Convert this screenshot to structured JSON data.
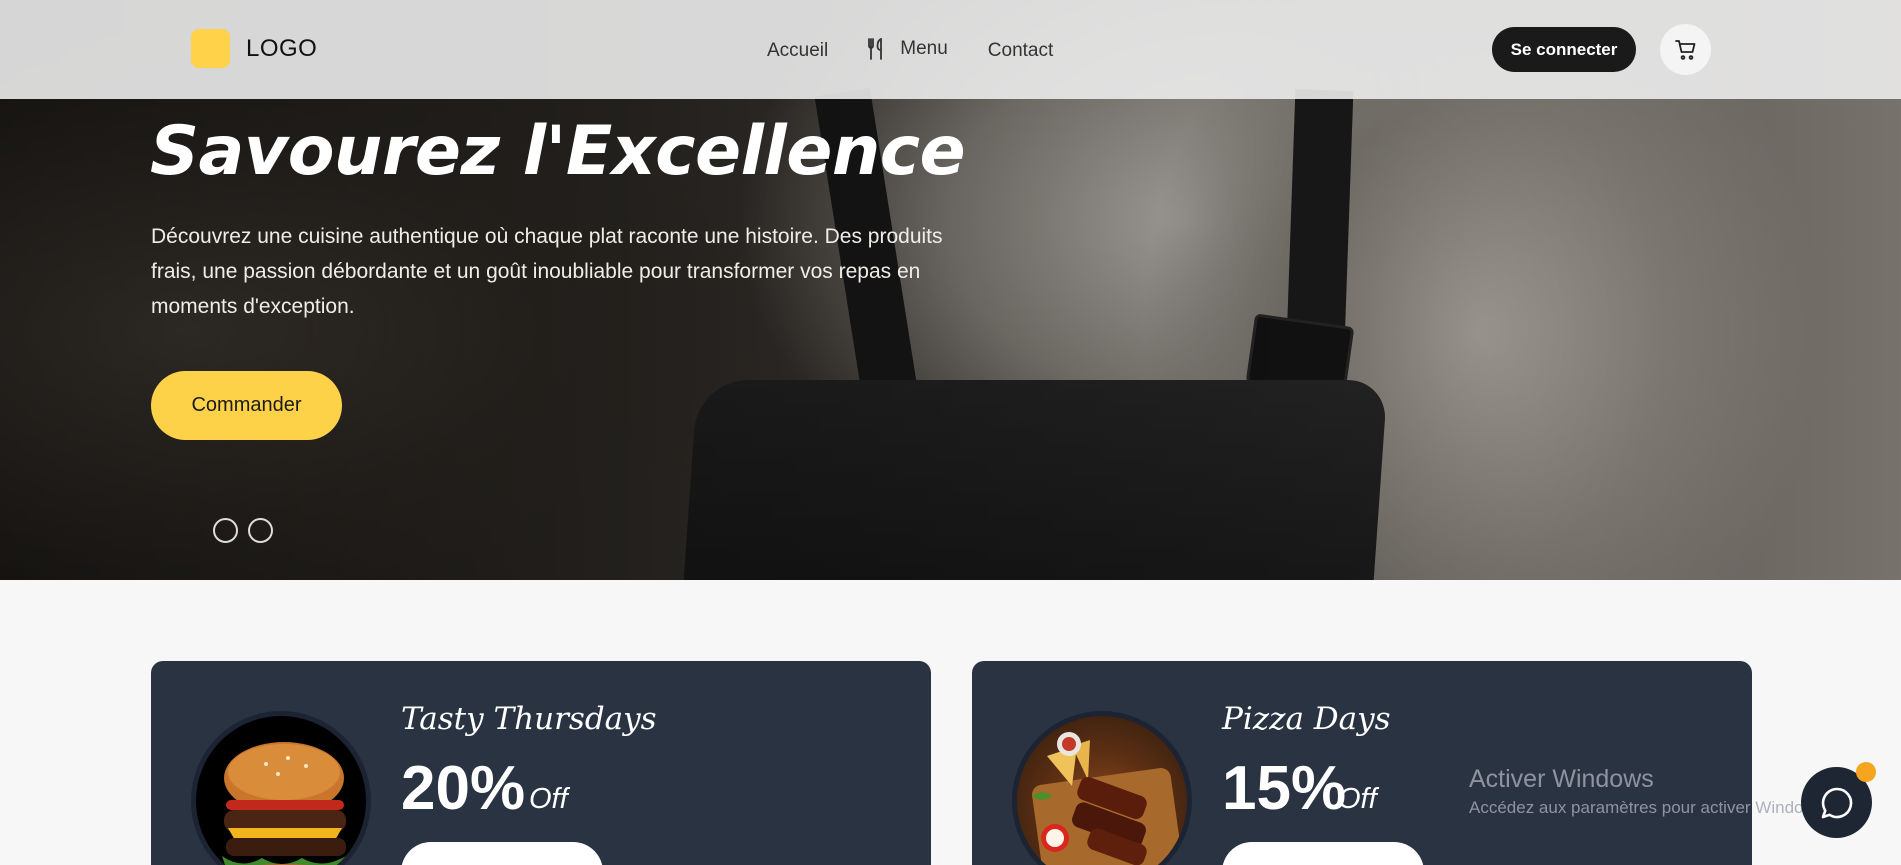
{
  "header": {
    "logo_text": "LOGO",
    "nav": {
      "accueil": "Accueil",
      "menu": "Menu",
      "contact": "Contact"
    },
    "login_label": "Se connecter"
  },
  "hero": {
    "title": "Savourez l'Excellence",
    "description": "Découvrez une cuisine authentique où chaque plat raconte une histoire. Des produits frais, une passion débordante et un goût inoubliable pour transformer vos repas en moments d'exception.",
    "cta_label": "Commander",
    "slides": 2
  },
  "promos": [
    {
      "title": "Tasty Thursdays",
      "percent": "20%",
      "off": "Off",
      "image": "burger-image"
    },
    {
      "title": "Pizza Days",
      "percent": "15%",
      "off": "Off",
      "image": "ribs-image"
    }
  ],
  "os_watermark": {
    "title": "Activer Windows",
    "subtitle": "Accédez aux paramètres pour activer Windows."
  },
  "icons": {
    "menu": "utensils-icon",
    "cart": "cart-icon",
    "chat": "chat-icon"
  },
  "colors": {
    "accent_yellow": "#fdd249",
    "dark_button": "#1a1a1a",
    "card_bg": "#2a3342",
    "chat_badge": "#f7a51f"
  }
}
